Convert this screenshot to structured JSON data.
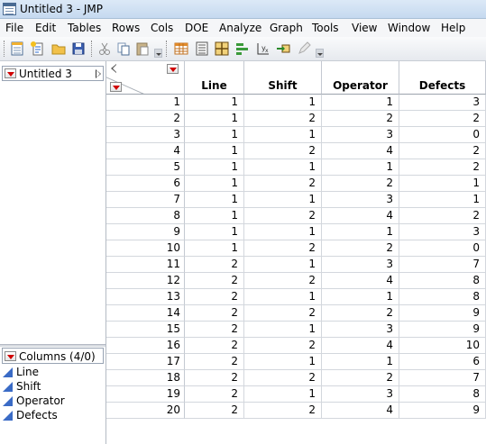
{
  "window": {
    "title": "Untitled 3 - JMP"
  },
  "menu": [
    "File",
    "Edit",
    "Tables",
    "Rows",
    "Cols",
    "DOE",
    "Analyze",
    "Graph",
    "Tools",
    "View",
    "Window",
    "Help"
  ],
  "toolbar": {
    "icons": [
      "new-data-table-icon",
      "new-script-icon",
      "open-icon",
      "save-icon",
      "cut-icon",
      "copy-icon",
      "paste-icon",
      "data-table-icon",
      "table-list-icon",
      "grid-icon",
      "bar-chart-icon",
      "formula-icon",
      "arrow-table-icon",
      "edit-icon"
    ]
  },
  "left_panel": {
    "table_name": "Untitled 3",
    "columns_header": "Columns (4/0)",
    "columns": [
      "Line",
      "Shift",
      "Operator",
      "Defects"
    ]
  },
  "grid": {
    "headers": [
      "Line",
      "Shift",
      "Operator",
      "Defects"
    ],
    "rows": [
      [
        "1",
        "1",
        "1",
        "1",
        "3"
      ],
      [
        "2",
        "1",
        "2",
        "2",
        "2"
      ],
      [
        "3",
        "1",
        "1",
        "3",
        "0"
      ],
      [
        "4",
        "1",
        "2",
        "4",
        "2"
      ],
      [
        "5",
        "1",
        "1",
        "1",
        "2"
      ],
      [
        "6",
        "1",
        "2",
        "2",
        "1"
      ],
      [
        "7",
        "1",
        "1",
        "3",
        "1"
      ],
      [
        "8",
        "1",
        "2",
        "4",
        "2"
      ],
      [
        "9",
        "1",
        "1",
        "1",
        "3"
      ],
      [
        "10",
        "1",
        "2",
        "2",
        "0"
      ],
      [
        "11",
        "2",
        "1",
        "3",
        "7"
      ],
      [
        "12",
        "2",
        "2",
        "4",
        "8"
      ],
      [
        "13",
        "2",
        "1",
        "1",
        "8"
      ],
      [
        "14",
        "2",
        "2",
        "2",
        "9"
      ],
      [
        "15",
        "2",
        "1",
        "3",
        "9"
      ],
      [
        "16",
        "2",
        "2",
        "4",
        "10"
      ],
      [
        "17",
        "2",
        "1",
        "1",
        "6"
      ],
      [
        "18",
        "2",
        "2",
        "2",
        "7"
      ],
      [
        "19",
        "2",
        "1",
        "3",
        "8"
      ],
      [
        "20",
        "2",
        "2",
        "4",
        "9"
      ]
    ]
  }
}
